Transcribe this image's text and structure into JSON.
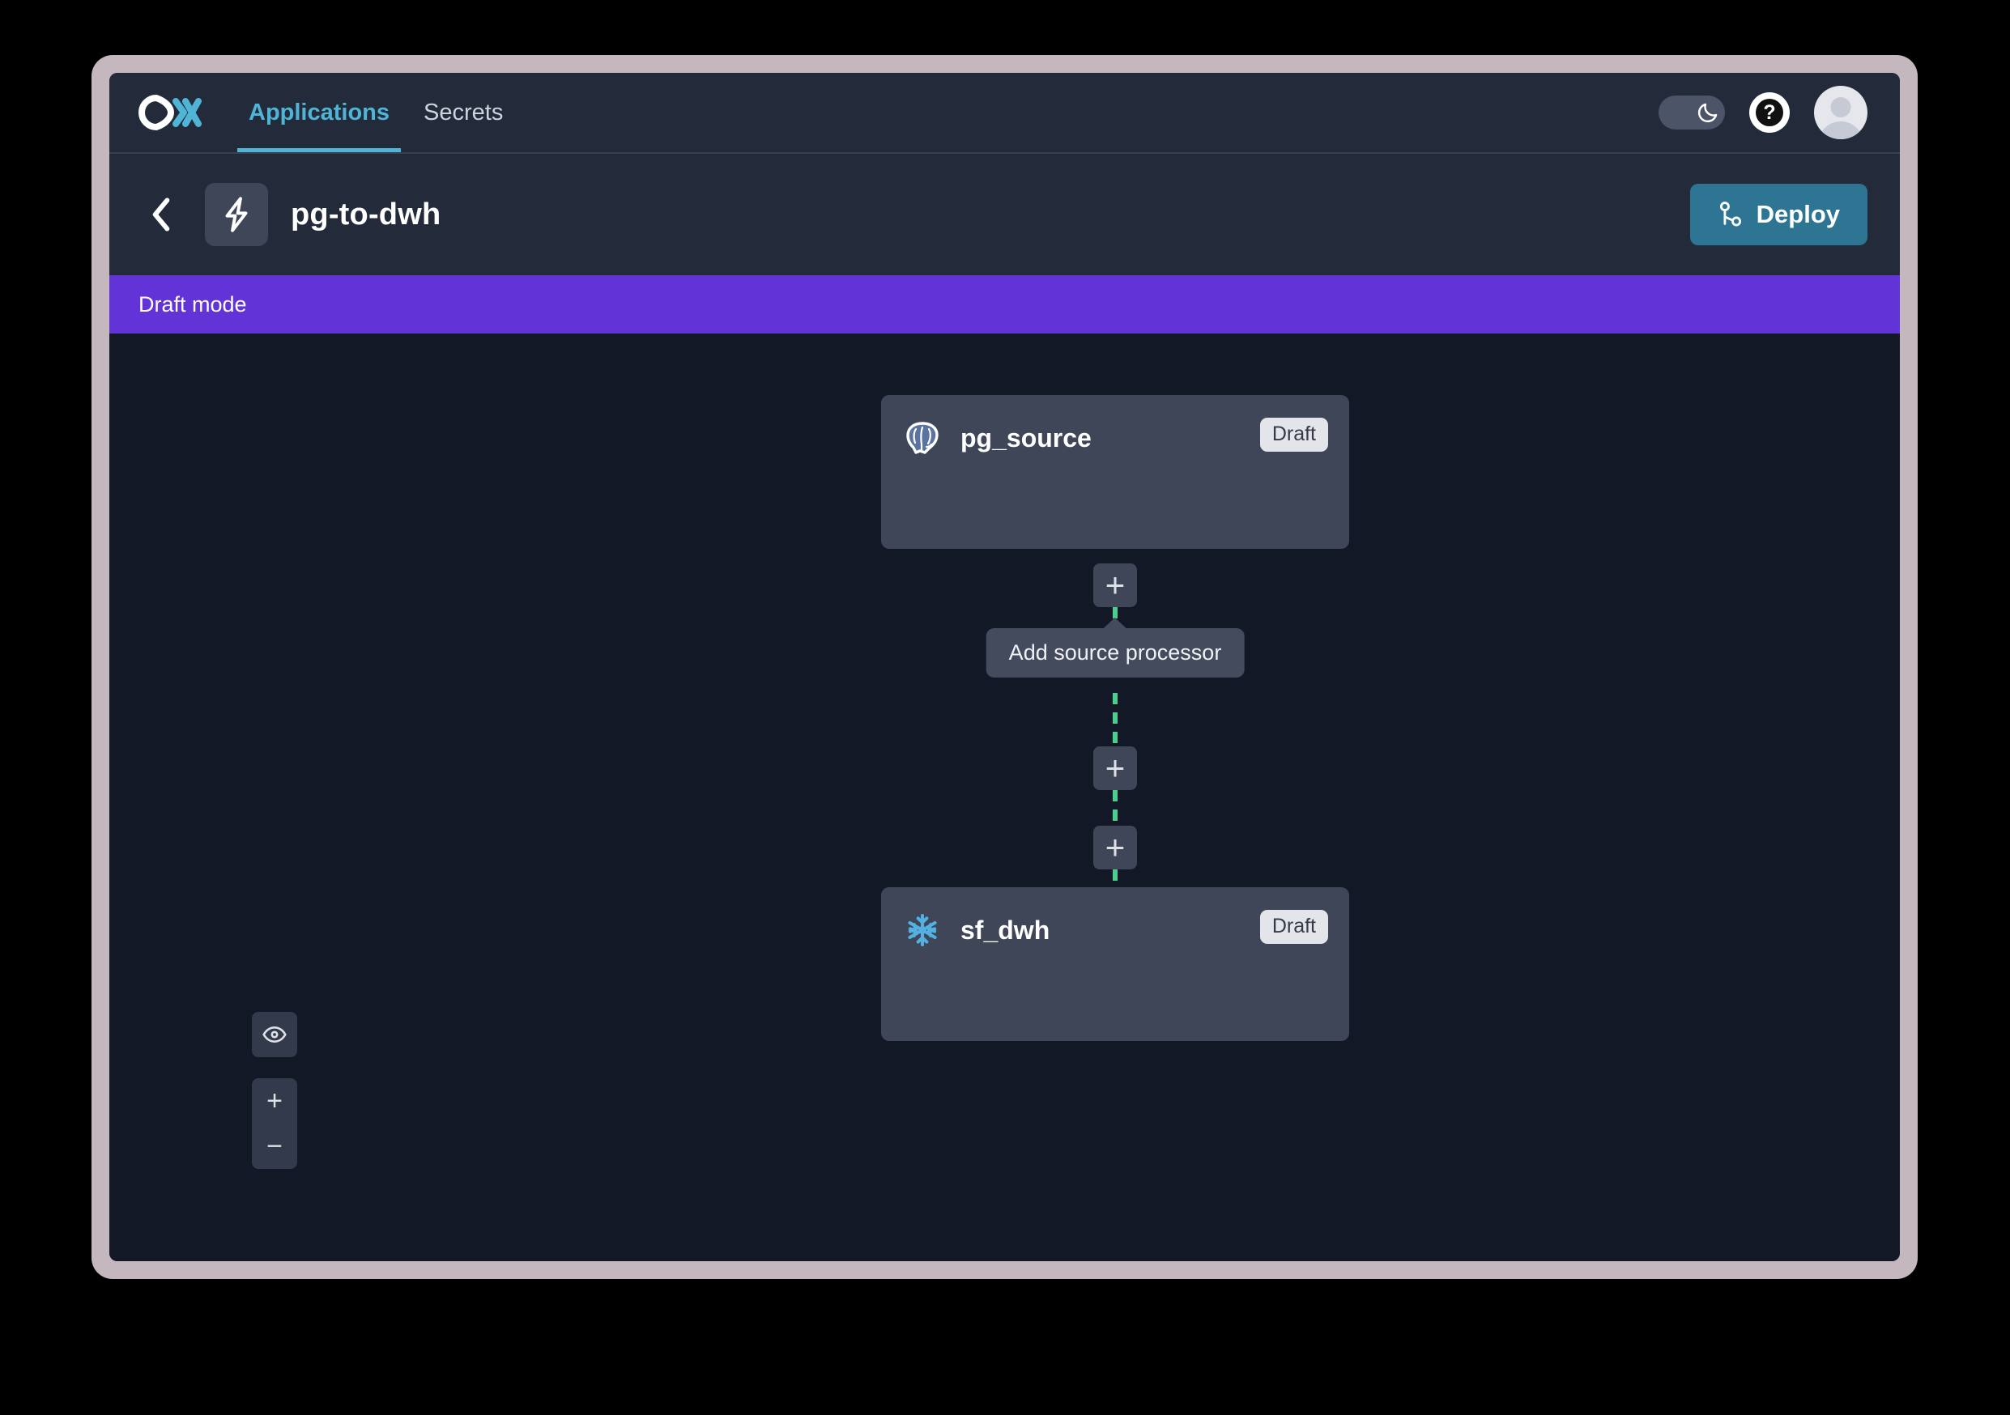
{
  "brand": {
    "logo_name": "conduit-logo",
    "accent": "#4FB4D6"
  },
  "topnav": {
    "tabs": [
      {
        "label": "Applications",
        "active": true
      },
      {
        "label": "Secrets",
        "active": false
      }
    ],
    "theme_toggle_icon": "moon-icon",
    "help_label": "?",
    "avatar_name": "user-avatar"
  },
  "app_header": {
    "back_icon": "chevron-left-icon",
    "app_icon": "lightning-bolt-icon",
    "title": "pg-to-dwh",
    "deploy_label": "Deploy",
    "deploy_icon": "git-branch-icon",
    "deploy_color": "#2E7593"
  },
  "banner": {
    "text": "Draft mode",
    "color": "#6233D6"
  },
  "flow": {
    "edge_color": "#4ECB8E",
    "nodes": [
      {
        "name": "pg_source",
        "icon": "postgresql-icon",
        "status": "Draft"
      },
      {
        "name": "sf_dwh",
        "icon": "snowflake-icon",
        "status": "Draft"
      }
    ],
    "add_buttons": [
      {
        "glyph": "+",
        "tooltip": "Add source processor"
      },
      {
        "glyph": "+",
        "tooltip": ""
      },
      {
        "glyph": "+",
        "tooltip": ""
      }
    ],
    "visible_tooltip": "Add source processor"
  },
  "canvas_controls": {
    "fit_view_icon": "eye-icon",
    "zoom_in_label": "+",
    "zoom_out_label": "−"
  }
}
